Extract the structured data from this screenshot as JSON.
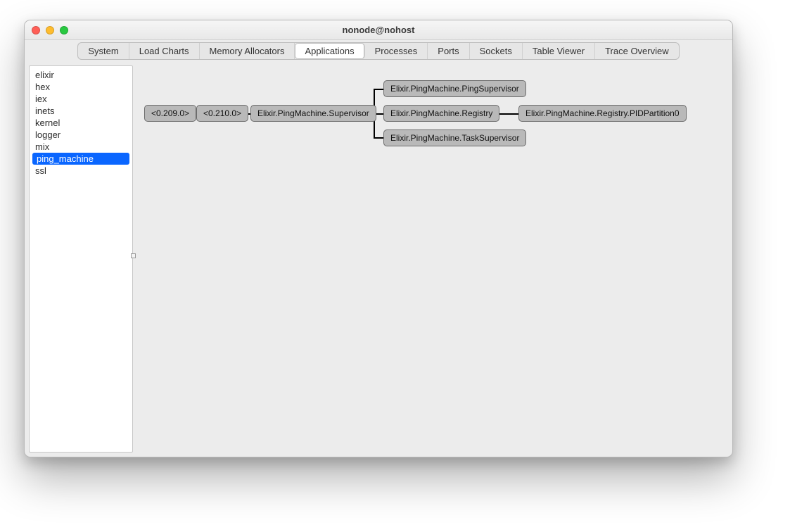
{
  "window": {
    "title": "nonode@nohost"
  },
  "tabs": {
    "items": [
      "System",
      "Load Charts",
      "Memory Allocators",
      "Applications",
      "Processes",
      "Ports",
      "Sockets",
      "Table Viewer",
      "Trace Overview"
    ],
    "active_index": 3
  },
  "sidebar": {
    "apps": [
      "elixir",
      "hex",
      "iex",
      "inets",
      "kernel",
      "logger",
      "mix",
      "ping_machine",
      "ssl"
    ],
    "selected_index": 7
  },
  "tree": {
    "n0": "<0.209.0>",
    "n1": "<0.210.0>",
    "n2": "Elixir.PingMachine.Supervisor",
    "n3": "Elixir.PingMachine.PingSupervisor",
    "n4": "Elixir.PingMachine.Registry",
    "n5": "Elixir.PingMachine.TaskSupervisor",
    "n6": "Elixir.PingMachine.Registry.PIDPartition0"
  }
}
